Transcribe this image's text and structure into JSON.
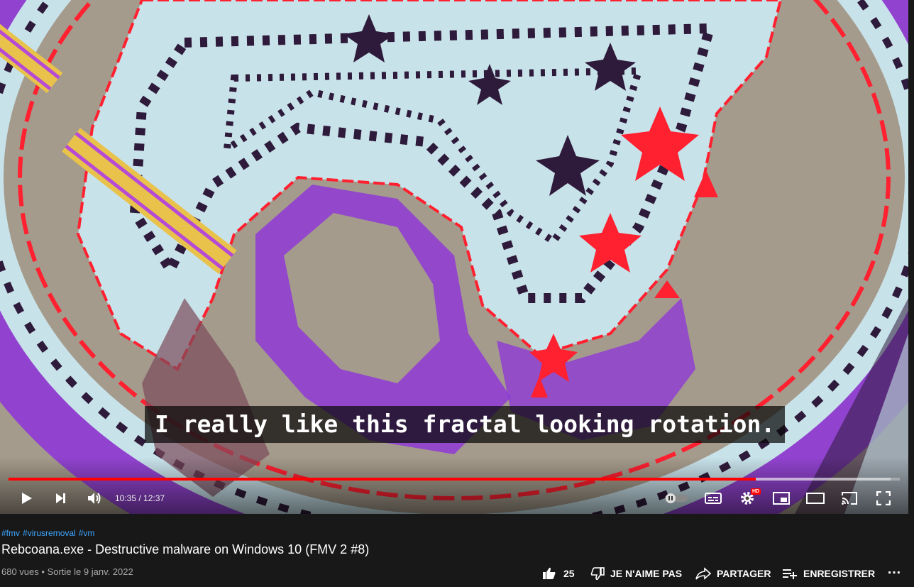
{
  "player": {
    "subtitle": "I really like this fractal looking rotation.",
    "time_current": "10:35",
    "time_sep": " / ",
    "time_total": "12:37",
    "progress_played_fraction": 0.838,
    "progress_loaded_fraction": 0.99,
    "hd_badge": "HD",
    "colors": {
      "progress": "#ff0000",
      "art_purple": "#8f3ad6",
      "art_red": "#ff2030",
      "art_pale": "#c8e2ea",
      "art_dark": "#2e1a3a",
      "art_bg": "#a59b8c"
    },
    "icons": [
      "play-icon",
      "next-icon",
      "volume-icon",
      "autoplay-toggle-icon",
      "subtitles-icon",
      "settings-icon",
      "miniplayer-icon",
      "theater-mode-icon",
      "cast-icon",
      "fullscreen-icon"
    ]
  },
  "video": {
    "hashtags": [
      "#fmv",
      "#virusremoval",
      "#vm"
    ],
    "title": "Rebcoana.exe - Destructive malware on Windows 10 (FMV 2 #8)",
    "views": "680 vues",
    "separator": "•",
    "date": "Sortie le 9 janv. 2022"
  },
  "actions": {
    "like_count": "25",
    "dislike_label": "JE N'AIME PAS",
    "share_label": "PARTAGER",
    "save_label": "ENREGISTRER",
    "more_label": "…"
  }
}
